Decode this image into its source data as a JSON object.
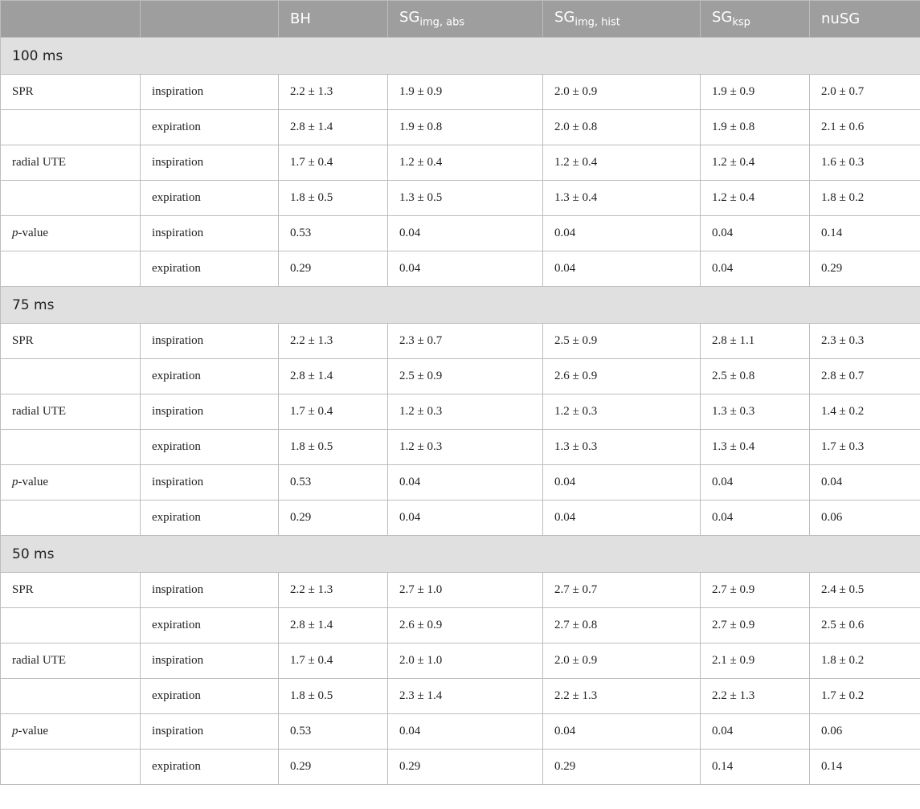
{
  "header": {
    "col0": "",
    "col1": "",
    "bh": "BH",
    "sg_abs_base": "SG",
    "sg_abs_sub": "img, abs",
    "sg_hist_base": "SG",
    "sg_hist_sub": "img, hist",
    "sg_ksp_base": "SG",
    "sg_ksp_sub": "ksp",
    "nusg": "nuSG"
  },
  "sections": [
    {
      "title": "100 ms",
      "rows": [
        {
          "method": "SPR",
          "phase": "inspiration",
          "values": [
            "2.2 ± 1.3",
            "1.9 ± 0.9",
            "2.0 ± 0.9",
            "1.9 ± 0.9",
            "2.0 ± 0.7"
          ]
        },
        {
          "method": "",
          "phase": "expiration",
          "values": [
            "2.8 ± 1.4",
            "1.9 ± 0.8",
            "2.0 ± 0.8",
            "1.9 ± 0.8",
            "2.1 ± 0.6"
          ]
        },
        {
          "method": "radial UTE",
          "phase": "inspiration",
          "values": [
            "1.7 ± 0.4",
            "1.2 ± 0.4",
            "1.2 ± 0.4",
            "1.2 ± 0.4",
            "1.6 ± 0.3"
          ]
        },
        {
          "method": "",
          "phase": "expiration",
          "values": [
            "1.8 ± 0.5",
            "1.3 ± 0.5",
            "1.3 ± 0.4",
            "1.2 ± 0.4",
            "1.8 ± 0.2"
          ]
        },
        {
          "method_italic": "p",
          "method_rest": "-value",
          "phase": "inspiration",
          "values": [
            "0.53",
            "0.04",
            "0.04",
            "0.04",
            "0.14"
          ]
        },
        {
          "method": "",
          "phase": "expiration",
          "values": [
            "0.29",
            "0.04",
            "0.04",
            "0.04",
            "0.29"
          ]
        }
      ]
    },
    {
      "title": "75 ms",
      "rows": [
        {
          "method": "SPR",
          "phase": "inspiration",
          "values": [
            "2.2 ± 1.3",
            "2.3 ± 0.7",
            "2.5 ± 0.9",
            "2.8 ± 1.1",
            "2.3 ± 0.3"
          ]
        },
        {
          "method": "",
          "phase": "expiration",
          "values": [
            "2.8 ± 1.4",
            "2.5 ± 0.9",
            "2.6 ± 0.9",
            "2.5 ± 0.8",
            "2.8 ± 0.7"
          ]
        },
        {
          "method": "radial UTE",
          "phase": "inspiration",
          "values": [
            "1.7 ± 0.4",
            "1.2 ± 0.3",
            "1.2 ± 0.3",
            "1.3 ± 0.3",
            "1.4 ± 0.2"
          ]
        },
        {
          "method": "",
          "phase": "expiration",
          "values": [
            "1.8 ± 0.5",
            "1.2 ± 0.3",
            "1.3 ± 0.3",
            "1.3 ± 0.4",
            "1.7 ± 0.3"
          ]
        },
        {
          "method_italic": "p",
          "method_rest": "-value",
          "phase": "inspiration",
          "values": [
            "0.53",
            "0.04",
            "0.04",
            "0.04",
            "0.04"
          ]
        },
        {
          "method": "",
          "phase": "expiration",
          "values": [
            "0.29",
            "0.04",
            "0.04",
            "0.04",
            "0.06"
          ]
        }
      ]
    },
    {
      "title": "50 ms",
      "rows": [
        {
          "method": "SPR",
          "phase": "inspiration",
          "values": [
            "2.2 ± 1.3",
            "2.7 ± 1.0",
            "2.7 ± 0.7",
            "2.7 ± 0.9",
            "2.4 ± 0.5"
          ]
        },
        {
          "method": "",
          "phase": "expiration",
          "values": [
            "2.8 ± 1.4",
            "2.6 ± 0.9",
            "2.7 ± 0.8",
            "2.7 ± 0.9",
            "2.5 ± 0.6"
          ]
        },
        {
          "method": "radial UTE",
          "phase": "inspiration",
          "values": [
            "1.7 ± 0.4",
            "2.0 ± 1.0",
            "2.0 ± 0.9",
            "2.1 ± 0.9",
            "1.8 ± 0.2"
          ]
        },
        {
          "method": "",
          "phase": "expiration",
          "values": [
            "1.8 ± 0.5",
            "2.3 ± 1.4",
            "2.2 ± 1.3",
            "2.2 ± 1.3",
            "1.7 ± 0.2"
          ]
        },
        {
          "method_italic": "p",
          "method_rest": "-value",
          "phase": "inspiration",
          "values": [
            "0.53",
            "0.04",
            "0.04",
            "0.04",
            "0.06"
          ]
        },
        {
          "method": "",
          "phase": "expiration",
          "values": [
            "0.29",
            "0.29",
            "0.29",
            "0.14",
            "0.14"
          ]
        }
      ]
    }
  ]
}
